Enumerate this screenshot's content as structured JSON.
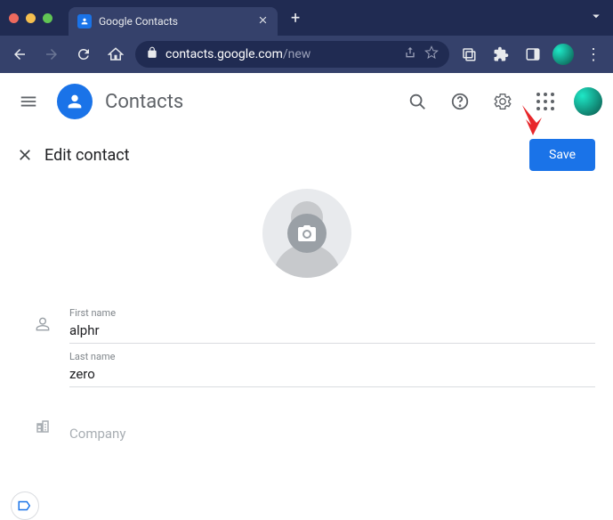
{
  "browser": {
    "tab_title": "Google Contacts",
    "url_domain": "contacts.google.com",
    "url_path": "/new"
  },
  "app": {
    "name": "Contacts"
  },
  "edit": {
    "title": "Edit contact",
    "save_label": "Save"
  },
  "form": {
    "first_name_label": "First name",
    "first_name_value": "alphr",
    "last_name_label": "Last name",
    "last_name_value": "zero",
    "company_placeholder": "Company"
  }
}
